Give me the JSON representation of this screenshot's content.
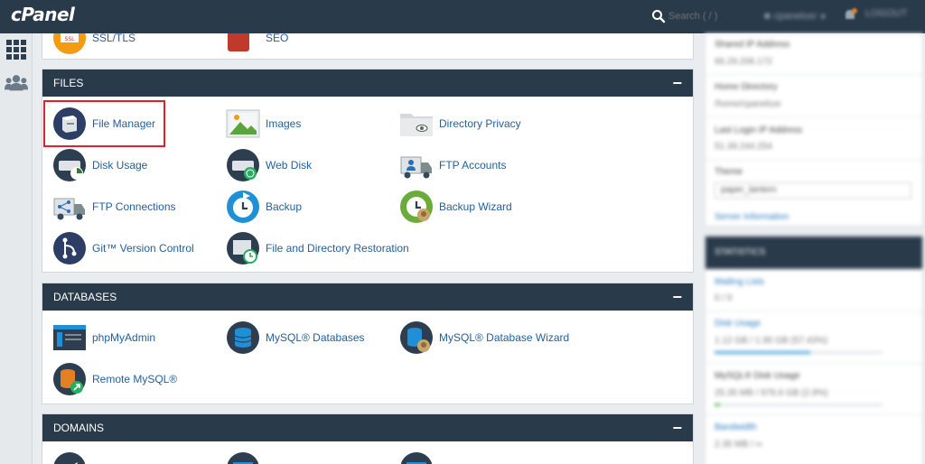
{
  "app": {
    "logo": "cPanel"
  },
  "header": {
    "search_placeholder": "Search ( / )",
    "user": "cpanelusr",
    "notification_count": "1",
    "logout": "LOGOUT"
  },
  "above_fold": {
    "items": [
      {
        "label": "SSL/TLS"
      },
      {
        "label": "SEO"
      }
    ]
  },
  "files": {
    "title": "FILES",
    "collapse": "−",
    "items": [
      {
        "label": "File Manager"
      },
      {
        "label": "Images"
      },
      {
        "label": "Directory Privacy"
      },
      {
        "label": "Disk Usage"
      },
      {
        "label": "Web Disk"
      },
      {
        "label": "FTP Accounts"
      },
      {
        "label": "FTP Connections"
      },
      {
        "label": "Backup"
      },
      {
        "label": "Backup Wizard"
      },
      {
        "label": "Git™ Version Control"
      },
      {
        "label": "File and Directory Restoration"
      }
    ]
  },
  "databases": {
    "title": "DATABASES",
    "collapse": "−",
    "items": [
      {
        "label": "phpMyAdmin"
      },
      {
        "label": "MySQL® Databases"
      },
      {
        "label": "MySQL® Database Wizard"
      },
      {
        "label": "Remote MySQL®"
      }
    ]
  },
  "domains": {
    "title": "DOMAINS",
    "collapse": "−"
  },
  "sidebar": {
    "shared_ip_label": "Shared IP Address",
    "shared_ip_value": "66.29.206.172",
    "home_dir_label": "Home Directory",
    "home_dir_value": "/home/cpanelusr",
    "last_login_label": "Last Login IP Address",
    "last_login_value": "51.39.244.254",
    "theme_label": "Theme",
    "theme_value": "paper_lantern",
    "server_info": "Server Information",
    "statistics_title": "STATISTICS",
    "mailing_lists_label": "Mailing Lists",
    "mailing_lists_value": "0 / 0",
    "disk_usage_label": "Disk Usage",
    "disk_usage_value": "1.12 GB / 1.95 GB (57.43%)",
    "disk_usage_fraction": 0.57,
    "mysql_usage_label": "MySQL® Disk Usage",
    "mysql_usage_value": "25.35 MB / 976.6 GB (2.9%)",
    "mysql_usage_fraction": 0.03,
    "bandwidth_label": "Bandwidth",
    "bandwidth_value": "2.35 MB / ∞"
  }
}
